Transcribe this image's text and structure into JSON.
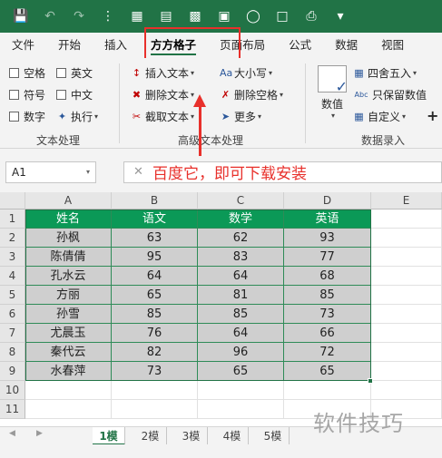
{
  "colors": {
    "brand": "#217346",
    "header_fill": "#0b9957",
    "cell_fill": "#cfcfcf",
    "annotation": "#e8302b"
  },
  "quick_access": [
    "save-icon",
    "undo-icon",
    "redo-icon",
    "sort-icon",
    "table-icon",
    "chart-icon",
    "pivot-icon",
    "screenshot-icon",
    "share-icon",
    "text-icon",
    "print-icon",
    "more-icon"
  ],
  "menu": {
    "tabs": [
      "文件",
      "开始",
      "插入",
      "方方格子",
      "页面布局",
      "公式",
      "数据",
      "视图"
    ],
    "active": "方方格子"
  },
  "ribbon": {
    "text_group": {
      "checkboxes": [
        "空格",
        "英文",
        "符号",
        "中文",
        "数字"
      ],
      "execute": "执行",
      "label": "文本处理"
    },
    "advanced_group": {
      "insert": "插入文本",
      "delete": "删除文本",
      "extract": "截取文本",
      "case": "大小写",
      "remove_space": "删除空格",
      "more": "更多",
      "label": "高级文本处理"
    },
    "number_group": {
      "value_btn": "数值",
      "round": "四舍五入",
      "keep_numbers": "只保留数值",
      "custom": "自定义",
      "label": "数据录入"
    }
  },
  "formula_bar": {
    "name_box": "A1"
  },
  "annotation": "百度它，即可下载安装",
  "sheet": {
    "columns": [
      "A",
      "B",
      "C",
      "D",
      "E"
    ],
    "rows": [
      "1",
      "2",
      "3",
      "4",
      "5",
      "6",
      "7",
      "8",
      "9",
      "10",
      "11"
    ],
    "header": [
      "姓名",
      "语文",
      "数学",
      "英语"
    ],
    "data": [
      [
        "孙枫",
        "63",
        "62",
        "93"
      ],
      [
        "陈倩倩",
        "95",
        "83",
        "77"
      ],
      [
        "孔水云",
        "64",
        "64",
        "68"
      ],
      [
        "方丽",
        "65",
        "81",
        "85"
      ],
      [
        "孙雪",
        "85",
        "85",
        "73"
      ],
      [
        "尤晨玉",
        "76",
        "64",
        "66"
      ],
      [
        "秦代云",
        "82",
        "96",
        "72"
      ],
      [
        "水春萍",
        "73",
        "65",
        "65"
      ]
    ]
  },
  "sheet_tabs": [
    "1模",
    "2模",
    "3模",
    "4模",
    "5模"
  ],
  "active_sheet": "1模",
  "watermark": "软件技巧"
}
